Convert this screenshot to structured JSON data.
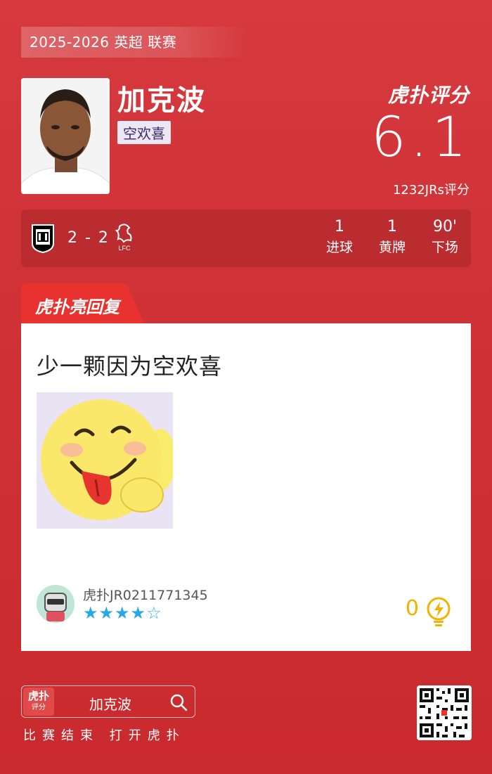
{
  "season": "2025-2026 英超 联赛",
  "player": {
    "name": "加克波",
    "nickname": "空欢喜"
  },
  "rating": {
    "brand": "虎扑评分",
    "score": "6.1",
    "count": "1232JRs评分"
  },
  "match": {
    "score": "2 - 2",
    "home_club_icon": "fulham-crest-icon",
    "away_club_icon": "liverpool-crest-icon",
    "stats": [
      {
        "value": "1",
        "label": "进球"
      },
      {
        "value": "1",
        "label": "黄牌"
      },
      {
        "value": "90'",
        "label": "下场"
      }
    ]
  },
  "section_tag": "虎扑亮回复",
  "reply": {
    "text": "少一颗因为空欢喜",
    "image_icon": "tongue-out-emoji-icon",
    "username": "虎扑JR0211771345",
    "stars": 4,
    "stars_max": 5,
    "likes": "0"
  },
  "footer": {
    "logo_text": "虎扑",
    "logo_subtext": "评分",
    "search_text": "加克波",
    "bottom_text": "比赛结束 打开虎扑"
  },
  "colors": {
    "background": "#cf3236",
    "star": "#29a8e8",
    "likes": "#f1b300"
  }
}
